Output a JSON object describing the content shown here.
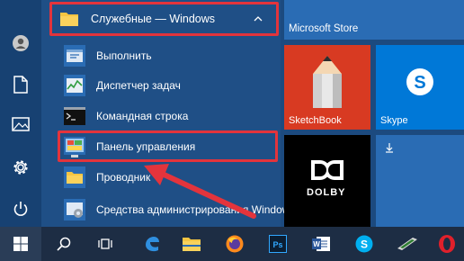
{
  "folder": {
    "label": "Служебные — Windows",
    "expanded": true
  },
  "apps": [
    {
      "label": "Выполнить",
      "icon": "run-icon"
    },
    {
      "label": "Диспетчер задач",
      "icon": "task-manager-icon"
    },
    {
      "label": "Командная строка",
      "icon": "command-prompt-icon"
    },
    {
      "label": "Панель управления",
      "icon": "control-panel-icon",
      "highlighted": true
    },
    {
      "label": "Проводник",
      "icon": "file-explorer-icon"
    },
    {
      "label": "Средства администрирования Windows",
      "icon": "admin-tools-icon"
    }
  ],
  "tiles": {
    "store": "Microsoft Store",
    "sketchbook": "SketchBook",
    "skype": "Skype",
    "dolby": "DOLBY"
  },
  "colors": {
    "accent_red": "#e3343c",
    "skype_blue": "#0078d7",
    "sketch_red": "#d83a22"
  },
  "taskbar": [
    "start-icon",
    "search-icon",
    "task-view-icon",
    "edge-icon",
    "file-explorer-icon",
    "firefox-icon",
    "photoshop-icon",
    "word-icon",
    "skype-icon",
    "winamp-icon",
    "opera-icon"
  ]
}
